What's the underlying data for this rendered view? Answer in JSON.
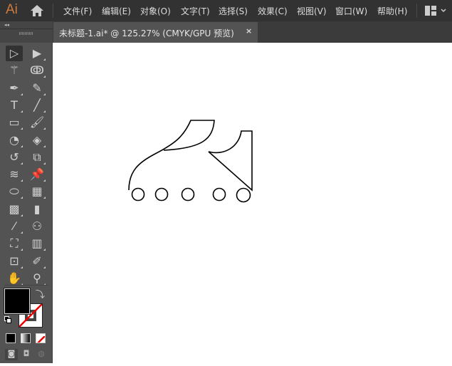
{
  "app": {
    "logo": "Ai"
  },
  "menu": [
    "文件(F)",
    "编辑(E)",
    "对象(O)",
    "文字(T)",
    "选择(S)",
    "效果(C)",
    "视图(V)",
    "窗口(W)",
    "帮助(H)"
  ],
  "document_tab": {
    "title": "未标题-1.ai* @ 125.27% (CMYK/GPU 预览)",
    "close": "×"
  },
  "tools": [
    [
      "selection-tool",
      "▷"
    ],
    [
      "direct-selection-tool",
      "▶"
    ],
    [
      "magic-wand-tool",
      "⚚"
    ],
    [
      "lasso-tool",
      "ↂ"
    ],
    [
      "pen-tool",
      "✒"
    ],
    [
      "curvature-tool",
      "✎"
    ],
    [
      "type-tool",
      "T"
    ],
    [
      "line-segment-tool",
      "╱"
    ],
    [
      "rectangle-tool",
      "▭"
    ],
    [
      "paintbrush-tool",
      "🖌"
    ],
    [
      "shaper-tool",
      "◔"
    ],
    [
      "eraser-tool",
      "◈"
    ],
    [
      "rotate-tool",
      "↺"
    ],
    [
      "scale-tool",
      "⧉"
    ],
    [
      "warp-tool",
      "≋"
    ],
    [
      "puppet-warp-tool",
      "📌"
    ],
    [
      "free-transform-tool",
      "⬭"
    ],
    [
      "perspective-grid-tool",
      "▦"
    ],
    [
      "mesh-tool",
      "▩"
    ],
    [
      "gradient-tool",
      "▮"
    ],
    [
      "eyedropper-tool",
      "⁄"
    ],
    [
      "blend-tool",
      "⚇"
    ],
    [
      "symbol-sprayer-tool",
      "⛶"
    ],
    [
      "column-graph-tool",
      "▥"
    ],
    [
      "artboard-tool",
      "⊡"
    ],
    [
      "slice-tool",
      "✐"
    ],
    [
      "hand-tool",
      "✋"
    ],
    [
      "zoom-tool",
      "⚲"
    ]
  ],
  "colors": {
    "fill": "#000000",
    "stroke": "none",
    "ui_bg": "#535353",
    "menubar": "#323232",
    "accent": "#d07a3e"
  }
}
